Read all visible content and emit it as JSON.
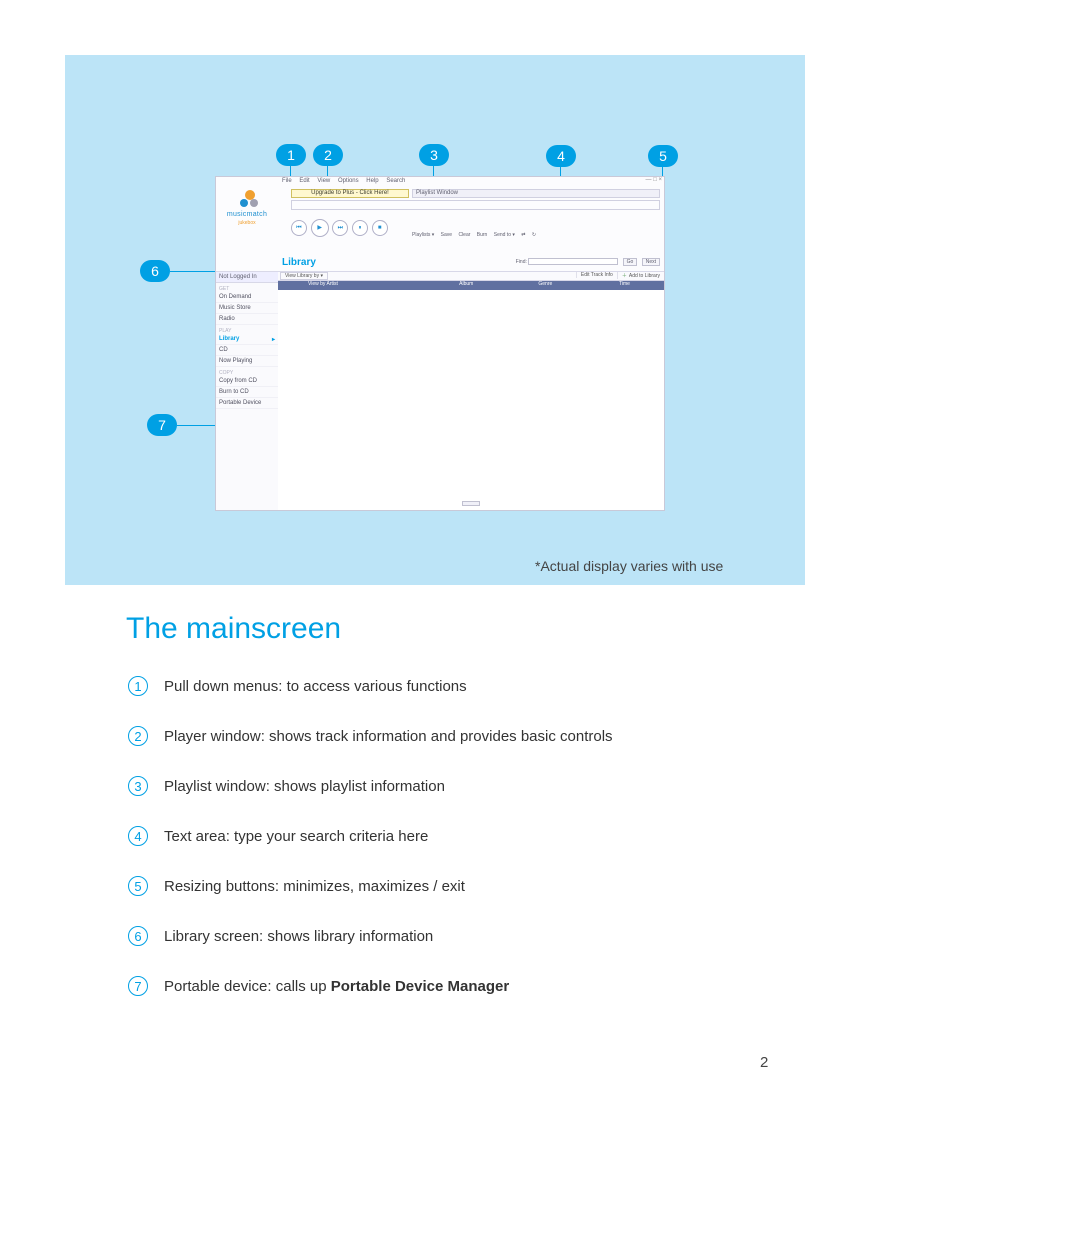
{
  "page_number": "2",
  "heading": "The mainscreen",
  "footnote": "*Actual display varies with use",
  "callouts": {
    "c1": "1",
    "c2": "2",
    "c3": "3",
    "c4": "4",
    "c5": "5",
    "c6": "6",
    "c7": "7"
  },
  "app": {
    "brand": "musicmatch",
    "brand_sub": "jukebox",
    "menu": {
      "file": "File",
      "edit": "Edit",
      "view": "View",
      "options": "Options",
      "help": "Help",
      "search": "Search"
    },
    "window_buttons": "— □ ×",
    "upgrade": "Upgrade to Plus - Click Here!",
    "playlist_header": "Playlist Window",
    "player_buttons": {
      "prev": "⏮",
      "play": "▶",
      "next": "⏭",
      "pause": "⏸",
      "stop": "■"
    },
    "playlist_toolbar": {
      "playlists": "Playlists ▾",
      "save": "Save",
      "clear": "Clear",
      "burn": "Burn",
      "sendto": "Send to ▾",
      "shuffle": "⇄",
      "repeat": "↻"
    },
    "library_title": "Library",
    "find": {
      "label": "Find:",
      "go": "Go",
      "next": "Next",
      "placeholder": ""
    },
    "sidebar": {
      "login": "Not Logged In",
      "sec_get": "GET",
      "on_demand": "On Demand",
      "music_store": "Music Store",
      "radio": "Radio",
      "sec_play": "PLAY",
      "library": "Library",
      "cd": "CD",
      "now_playing": "Now Playing",
      "sec_copy": "COPY",
      "copy_cd": "Copy from CD",
      "burn_cd": "Burn to CD",
      "portable": "Portable Device"
    },
    "lib_toolbar": {
      "view_by": "View Library by ▾",
      "edit_track": "Edit Track Info",
      "add_lib": "Add to Library"
    },
    "columns": {
      "artist": "View by Artist",
      "album": "Album",
      "genre": "Genre",
      "time": "Time"
    }
  },
  "legend": [
    {
      "n": "1",
      "text": "Pull down menus: to access various functions"
    },
    {
      "n": "2",
      "text": "Player window:  shows track information and provides basic controls"
    },
    {
      "n": "3",
      "text": "Playlist window:  shows playlist information"
    },
    {
      "n": "4",
      "text": "Text area: type your search criteria here"
    },
    {
      "n": "5",
      "text": "Resizing buttons: minimizes, maximizes / exit"
    },
    {
      "n": "6",
      "text": "Library screen:  shows library information"
    },
    {
      "n": "7",
      "text_pre": "Portable device: calls up ",
      "text_bold": "Portable Device Manager"
    }
  ]
}
